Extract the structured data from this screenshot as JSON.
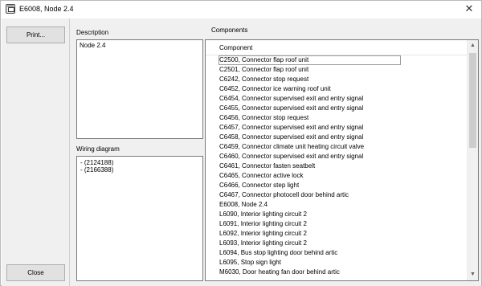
{
  "window": {
    "title": "E6008, Node 2.4",
    "close_glyph": "✕"
  },
  "buttons": {
    "print": "Print...",
    "close": "Close"
  },
  "description": {
    "label": "Description",
    "text": "Node 2.4"
  },
  "wiring": {
    "label": "Wiring diagram",
    "items": [
      "- (2124188)",
      "- (2166388)"
    ]
  },
  "components": {
    "label": "Components",
    "column_header": "Component",
    "items": [
      "C2500, Connector flap roof unit",
      "C2501, Connector flap roof unit",
      "C6242, Connector stop request",
      "C6452, Connector ice warning roof unit",
      "C6454, Connector supervised exit and entry signal",
      "C6455, Connector supervised exit and entry signal",
      "C6456, Connector stop request",
      "C6457, Connector supervised exit and entry signal",
      "C6458, Connector supervised exit and entry signal",
      "C6459, Connector climate unit heating circuit valve",
      "C6460, Connector supervised exit and entry signal",
      "C6461, Connector fasten seatbelt",
      "C6465, Connector active lock",
      "C6466, Connector step light",
      "C6467, Connector photocell door behind artic",
      "E6008, Node 2.4",
      "L6090, Interior lighting circuit 2",
      "L6091, Interior lighting circuit 2",
      "L6092, Interior lighting circuit 2",
      "L6093, Interior lighting circuit 2",
      "L6094, Bus stop lighting door behind artic",
      "L6095, Stop sign light",
      "M6030, Door heating fan door behind artic"
    ]
  },
  "scrollbar": {
    "up_glyph": "▲",
    "down_glyph": "▼"
  }
}
